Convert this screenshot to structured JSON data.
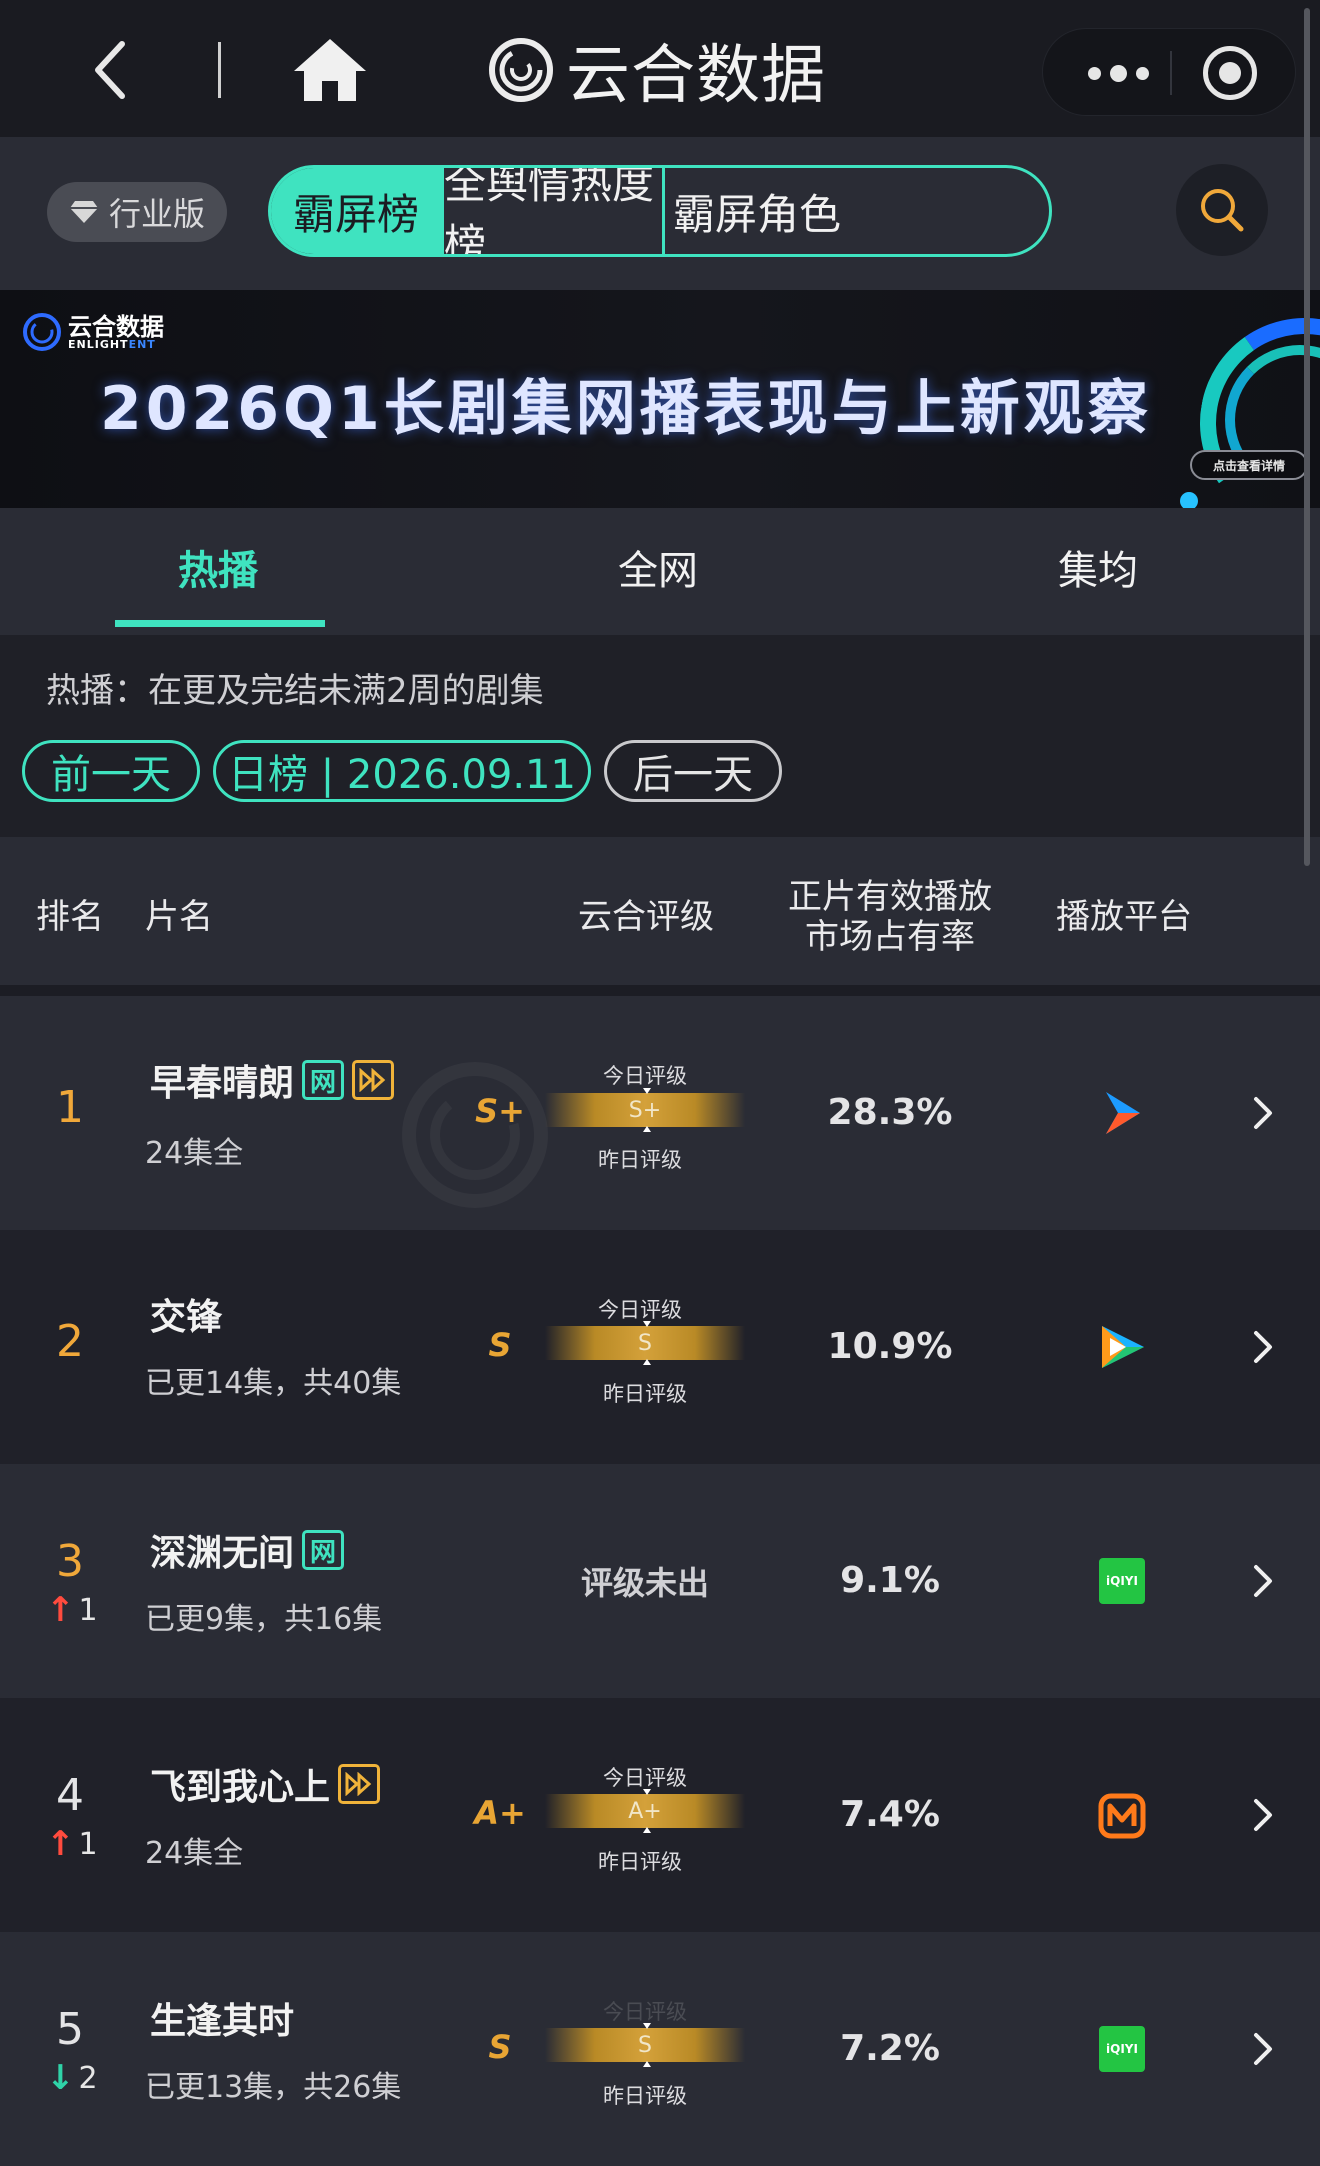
{
  "navbar": {
    "title": "云合数据"
  },
  "tabbar": {
    "edition_label": "行业版",
    "tabs": [
      "霸屏榜",
      "全舆情热度榜",
      "霸屏角色"
    ],
    "active_tab": 0
  },
  "banner": {
    "logo_cn": "云合数据",
    "logo_en_a": "ENLIGHT",
    "logo_en_b": "ENT",
    "headline": "2026Q1长剧集网播表现与上新观察",
    "cta": "点击查看详情"
  },
  "subtabs": {
    "items": [
      "热播",
      "全网",
      "集均"
    ],
    "active": 0
  },
  "hint": "热播：在更及完结未满2周的剧集",
  "date_nav": {
    "prev": "前一天",
    "current": "日榜 | 2026.09.11",
    "next": "后一天"
  },
  "table": {
    "headers": {
      "rank": "排名",
      "title": "片名",
      "grade": "云合评级",
      "share_line1": "正片有效播放",
      "share_line2": "市场占有率",
      "platform": "播放平台"
    },
    "today_grade_label": "今日评级",
    "yesterday_grade_label": "昨日评级",
    "no_grade_label": "评级未出",
    "rows": [
      {
        "rank": "1",
        "change": "",
        "title": "早春晴朗",
        "tags": [
          "网",
          "play"
        ],
        "episodes": "24集全",
        "grade": "S+",
        "bar_label": "S+",
        "share": "28.3%",
        "platform": "youku-icon"
      },
      {
        "rank": "2",
        "change": "",
        "title": "交锋",
        "tags": [],
        "episodes": "已更14集，共40集",
        "grade": "S",
        "bar_label": "S",
        "share": "10.9%",
        "platform": "tencent-video-icon"
      },
      {
        "rank": "3",
        "change": "1",
        "title": "深渊无间",
        "tags": [
          "网"
        ],
        "episodes": "已更9集，共16集",
        "grade": "",
        "bar_label": "",
        "share": "9.1%",
        "platform": "iqiyi-icon"
      },
      {
        "rank": "4",
        "change": "1",
        "title": "飞到我心上",
        "tags": [
          "play"
        ],
        "episodes": "24集全",
        "grade": "A+",
        "bar_label": "A+",
        "share": "7.4%",
        "platform": "mango-tv-icon"
      },
      {
        "rank": "5",
        "change": "2",
        "title": "生逢其时",
        "tags": [],
        "episodes": "已更13集，共26集",
        "grade": "S",
        "bar_label": "S",
        "share": "7.2%",
        "platform": "iqiyi-icon"
      }
    ],
    "platform_text": {
      "iqiyi": "iQIYI"
    }
  },
  "colors": {
    "accent": "#3fe3c0",
    "gold": "#e8a534",
    "rank_top": "#f0a83a",
    "up": "#ff4b3e",
    "down": "#2fd3a8"
  }
}
